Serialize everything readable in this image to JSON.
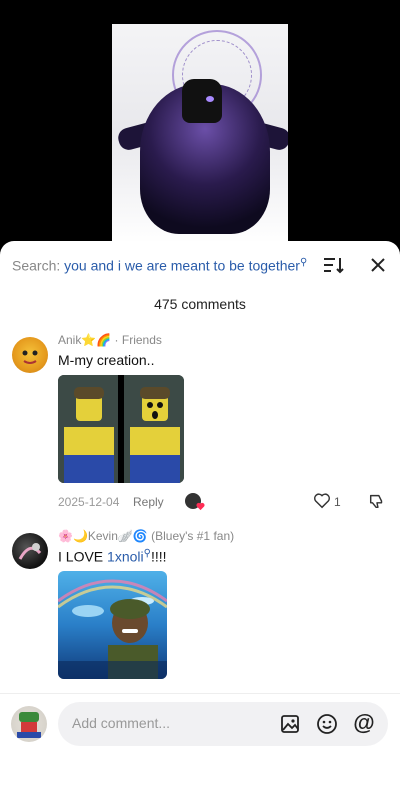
{
  "search": {
    "prefix": "Search:",
    "query": "you and i we are meant to be together"
  },
  "comments_count": "475 comments",
  "comments": [
    {
      "username": "Anik⭐🌈 · Friends",
      "text": "M-my creation..",
      "date": "2025-12-04",
      "reply_label": "Reply",
      "likes": "1"
    },
    {
      "username": "🌸🌙Kevin🪽🌀 (Bluey's #1 fan)",
      "text_prefix": "I LOVE ",
      "text_link": "1xnoli",
      "text_suffix": "!!!!"
    }
  ],
  "composer": {
    "placeholder": "Add comment..."
  },
  "icons": {
    "sort": "sort-icon",
    "close": "close-icon",
    "like": "heart-outline-icon",
    "dislike": "dislike-icon",
    "image": "image-icon",
    "emoji": "emoji-icon",
    "mention": "at-icon"
  },
  "colors": {
    "link": "#2a5caa",
    "background": "#ffffff",
    "video_bg": "#000000"
  }
}
